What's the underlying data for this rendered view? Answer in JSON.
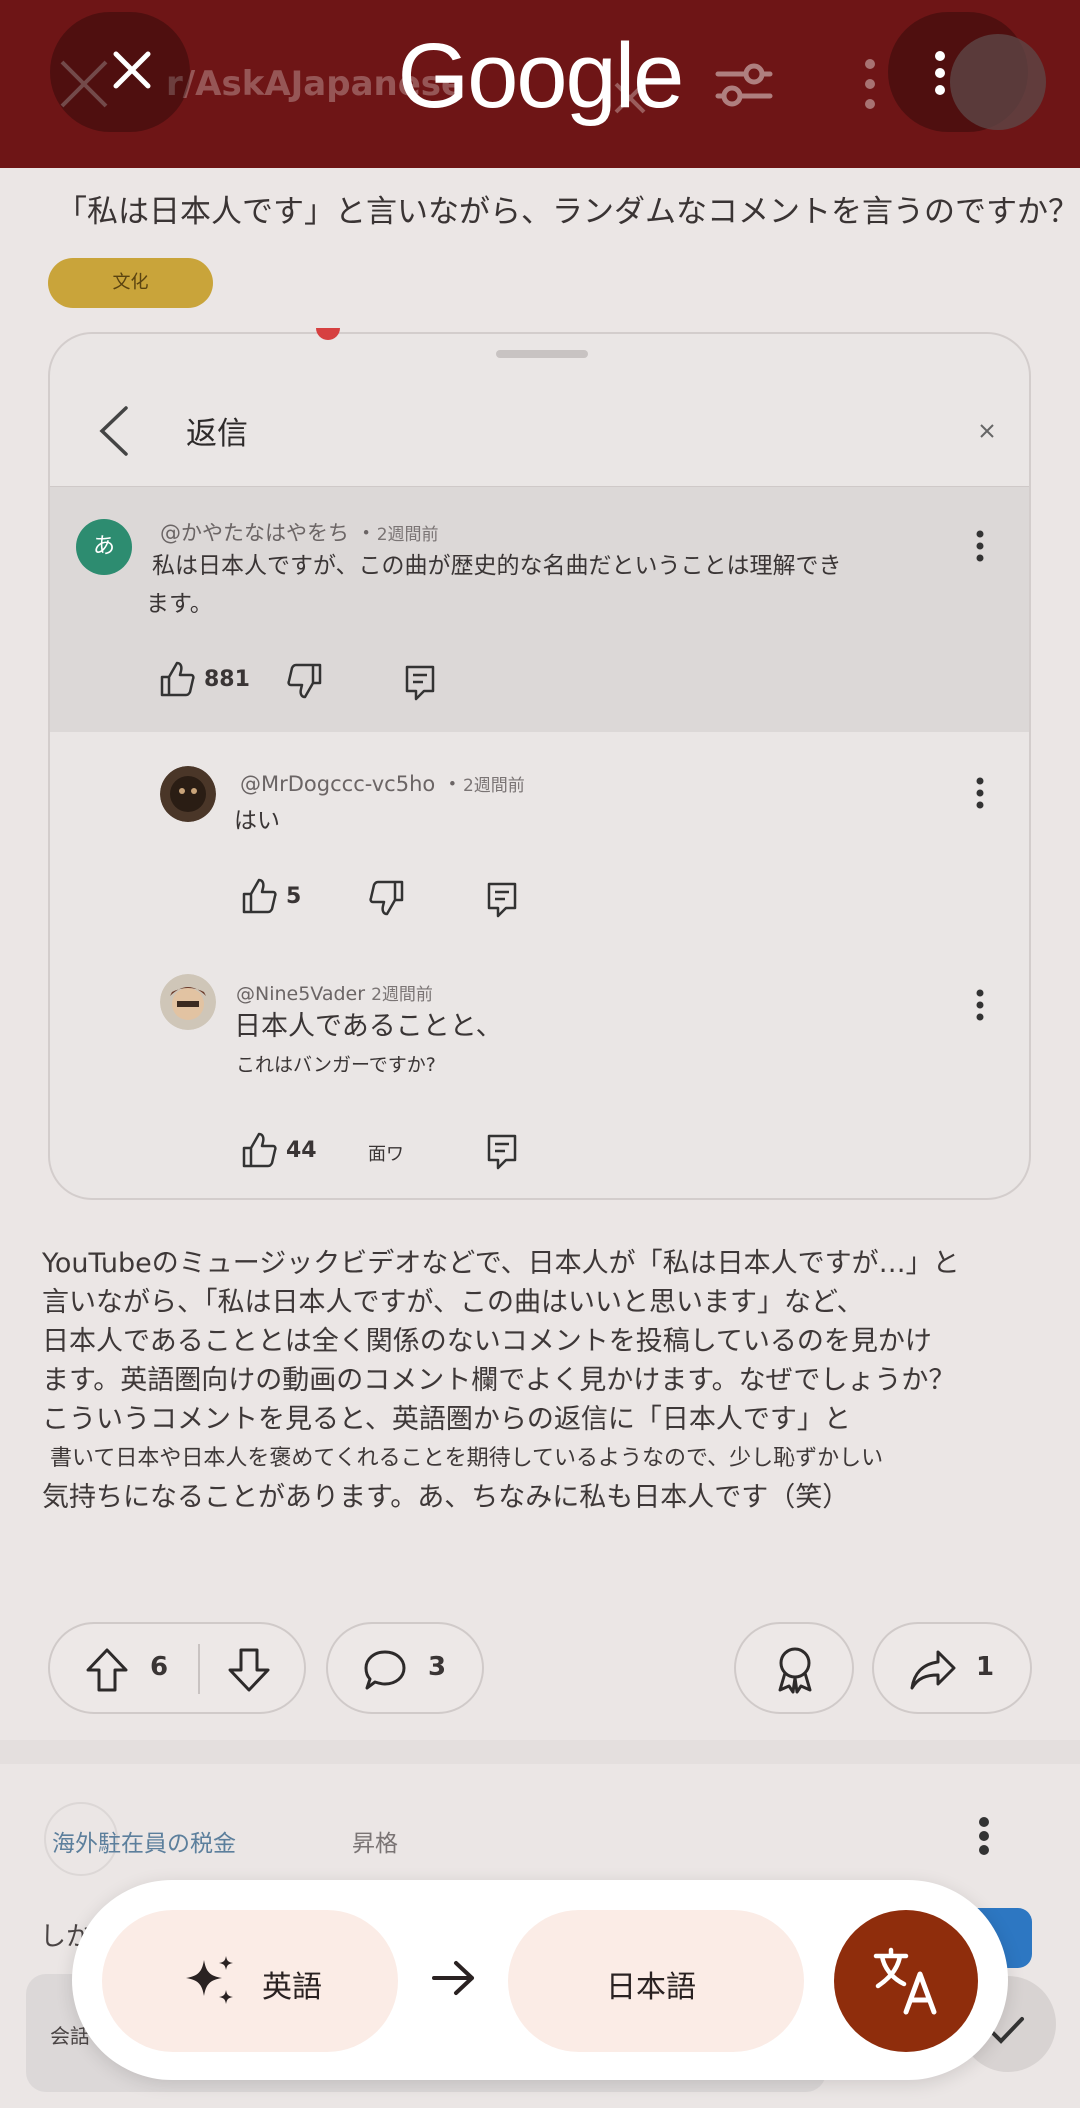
{
  "topbar": {
    "ghost_title": "r/AskAJapanese",
    "logo": "Google",
    "close_icon": "close-icon",
    "more_icon": "more-vertical-icon"
  },
  "post": {
    "title": "「私は日本人です」と言いながら、ランダムなコメントを言うのですか？",
    "tag": "文化",
    "body_lines": [
      "YouTubeのミュージックビデオなどで、日本人が「私は日本人ですが…」と",
      "言いながら、「私は日本人ですが、この曲はいいと思います」など、",
      "日本人であることとは全く関係のないコメントを投稿しているのを見かけ",
      "ます。英語圏向けの動画のコメント欄でよく見かけます。なぜでしょうか？",
      "こういうコメントを見ると、英語圏からの返信に「日本人です」と",
      "書いて日本や日本人を褒めてくれることを期待しているようなので、少し恥ずかしい",
      "気持ちになることがあります。あ、ちなみに私も日本人です（笑）"
    ],
    "upvotes": "6",
    "comments": "3",
    "shares": "1"
  },
  "reply_card": {
    "title": "返信",
    "comments": [
      {
        "avatar_letter": "あ",
        "author": "@かやたなはやをち",
        "time": "2週間前",
        "lines": [
          "私は日本人ですが、この曲が歴史的な名曲だということは理解でき",
          "ます。"
        ],
        "likes": "881"
      },
      {
        "author": "@MrDogccc-vc5ho",
        "time": "2週間前",
        "lines": [
          "はい"
        ],
        "likes": "5"
      },
      {
        "author": "@Nine5Vader",
        "time": "2週間前",
        "lines": [
          "日本人であることと、",
          "これはバンガーですか?"
        ],
        "likes": "44",
        "dislike_label": "面ワ"
      }
    ]
  },
  "related": {
    "link": "海外駐在員の税金",
    "rank": "昇格",
    "peek_text": "しか",
    "input_label": "会話"
  },
  "translate": {
    "source_lang": "英語",
    "target_lang": "日本語",
    "fab_icon": "translate-icon",
    "accent": "#8f2d0c"
  }
}
